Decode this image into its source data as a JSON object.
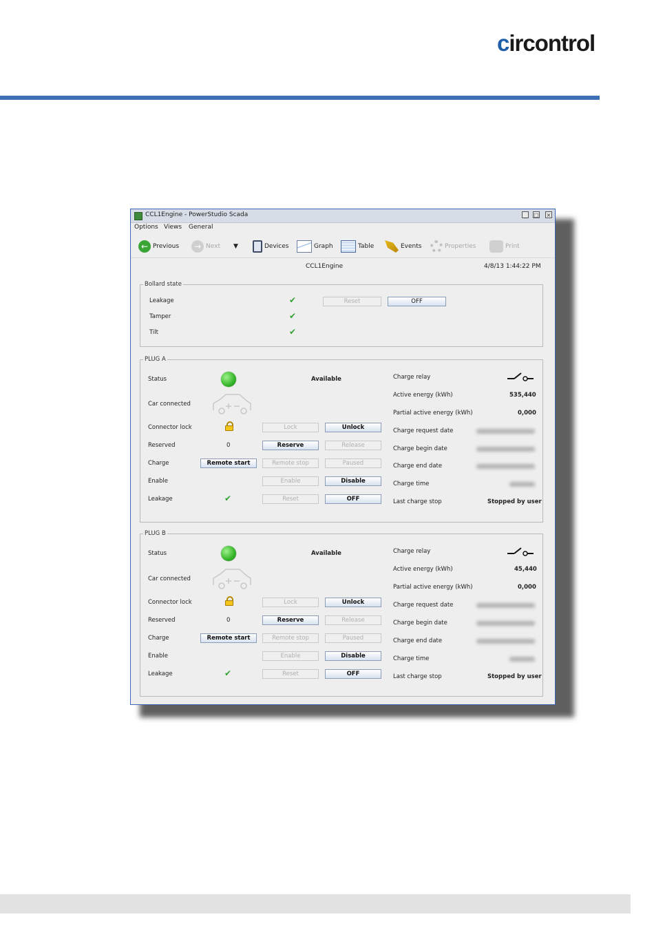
{
  "brand": {
    "logo_first": "c",
    "logo_rest": "ircontrol"
  },
  "window": {
    "title": "CCL1Engine - PowerStudio Scada",
    "menu": [
      "Options",
      "Views",
      "General"
    ],
    "toolbar": {
      "previous": "Previous",
      "next": "Next",
      "devices": "Devices",
      "graph": "Graph",
      "table": "Table",
      "events": "Events",
      "properties": "Properties",
      "print": "Print"
    },
    "device_name": "CCL1Engine",
    "datetime": "4/8/13 1:44:22 PM"
  },
  "bollard": {
    "legend": "Bollard state",
    "rows": [
      {
        "label": "Leakage"
      },
      {
        "label": "Tamper"
      },
      {
        "label": "Tilt"
      }
    ],
    "reset_label": "Reset",
    "off_label": "OFF"
  },
  "plugs": [
    {
      "legend": "PLUG A",
      "status_label": "Status",
      "status_value": "Available",
      "car_connected_label": "Car connected",
      "connector_lock_label": "Connector lock",
      "reserved_label": "Reserved",
      "reserved_value": "0",
      "charge_label": "Charge",
      "enable_label": "Enable",
      "leakage_label": "Leakage",
      "buttons": {
        "lock": "Lock",
        "unlock": "Unlock",
        "reserve": "Reserve",
        "release": "Release",
        "remote_start": "Remote start",
        "remote_stop": "Remote stop",
        "paused": "Paused",
        "enable": "Enable",
        "disable": "Disable",
        "reset": "Reset",
        "off": "OFF"
      },
      "info": {
        "charge_relay": "Charge relay",
        "active_energy_label": "Active energy (kWh)",
        "active_energy": "535,440",
        "partial_energy_label": "Partial active energy (kWh)",
        "partial_energy": "0,000",
        "request_date": "Charge request date",
        "begin_date": "Charge begin date",
        "end_date": "Charge end date",
        "charge_time": "Charge time",
        "last_stop_label": "Last charge stop",
        "last_stop": "Stopped by user"
      }
    },
    {
      "legend": "PLUG B",
      "status_label": "Status",
      "status_value": "Available",
      "car_connected_label": "Car connected",
      "connector_lock_label": "Connector lock",
      "reserved_label": "Reserved",
      "reserved_value": "0",
      "charge_label": "Charge",
      "enable_label": "Enable",
      "leakage_label": "Leakage",
      "buttons": {
        "lock": "Lock",
        "unlock": "Unlock",
        "reserve": "Reserve",
        "release": "Release",
        "remote_start": "Remote start",
        "remote_stop": "Remote stop",
        "paused": "Paused",
        "enable": "Enable",
        "disable": "Disable",
        "reset": "Reset",
        "off": "OFF"
      },
      "info": {
        "charge_relay": "Charge relay",
        "active_energy_label": "Active energy (kWh)",
        "active_energy": "45,440",
        "partial_energy_label": "Partial active energy (kWh)",
        "partial_energy": "0,000",
        "request_date": "Charge request date",
        "begin_date": "Charge begin date",
        "end_date": "Charge end date",
        "charge_time": "Charge time",
        "last_stop_label": "Last charge stop",
        "last_stop": "Stopped by user"
      }
    }
  ],
  "colors": {
    "accent": "#3b6fb6",
    "status_ok": "#35b52a",
    "window_border": "#3a66b6"
  }
}
